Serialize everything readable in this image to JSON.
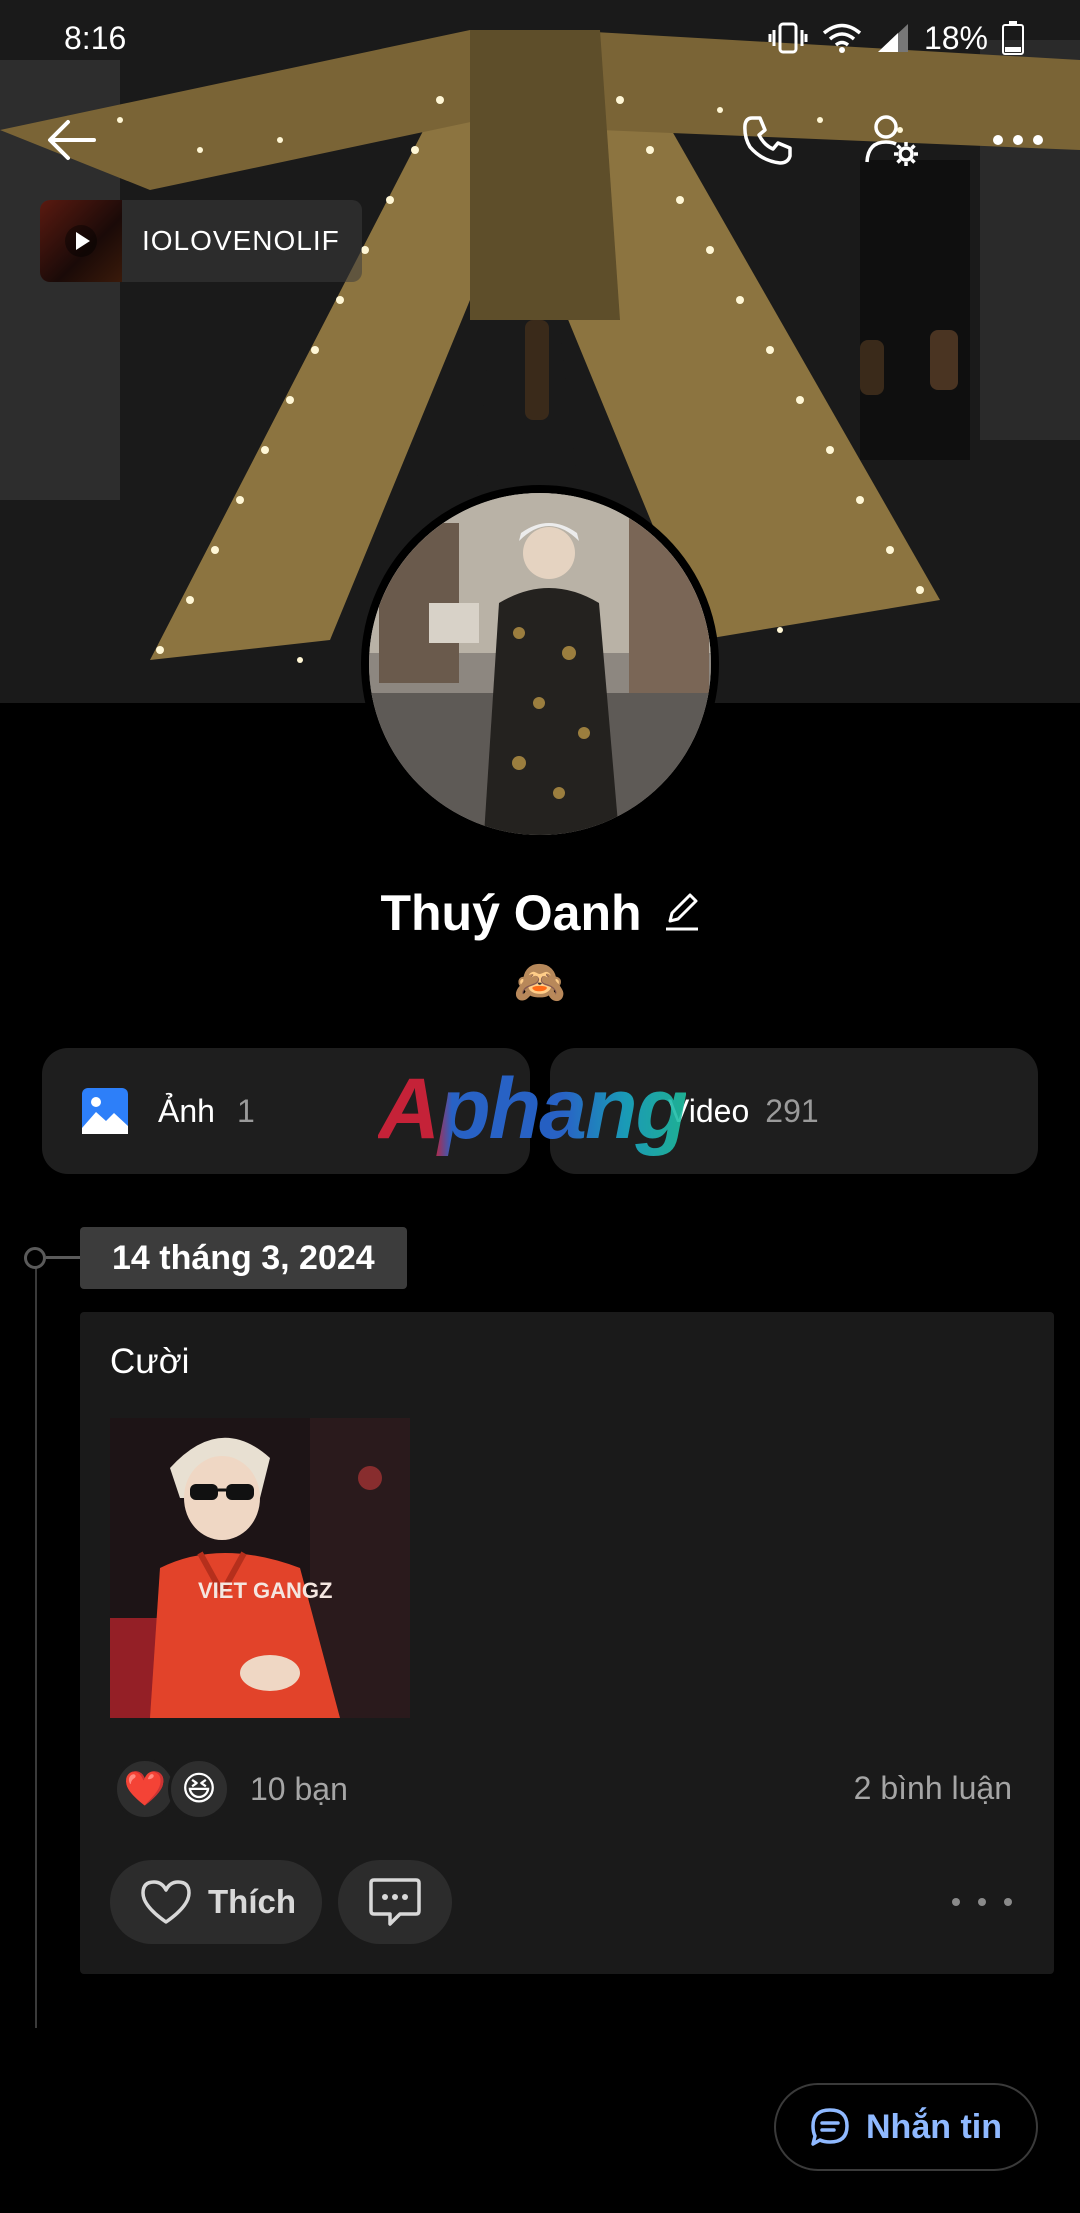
{
  "status_bar": {
    "time": "8:16",
    "battery": "18%"
  },
  "cover": {
    "music_title": "IOLOVENOLIF"
  },
  "profile": {
    "name": "Thuý Oanh",
    "emoji": "🙈"
  },
  "media": {
    "photos": {
      "label": "Ảnh",
      "count": "1"
    },
    "videos": {
      "label": "Video",
      "count": "291"
    }
  },
  "watermark": "Aphang",
  "timeline": {
    "date": "14 tháng 3, 2024",
    "post": {
      "text": "Cười",
      "reaction_emojis": [
        "❤️",
        "😆"
      ],
      "reaction_count": "10 bạn",
      "comment_count": "2 bình luận",
      "like_label": "Thích"
    }
  },
  "actions": {
    "message_label": "Nhắn tin"
  }
}
